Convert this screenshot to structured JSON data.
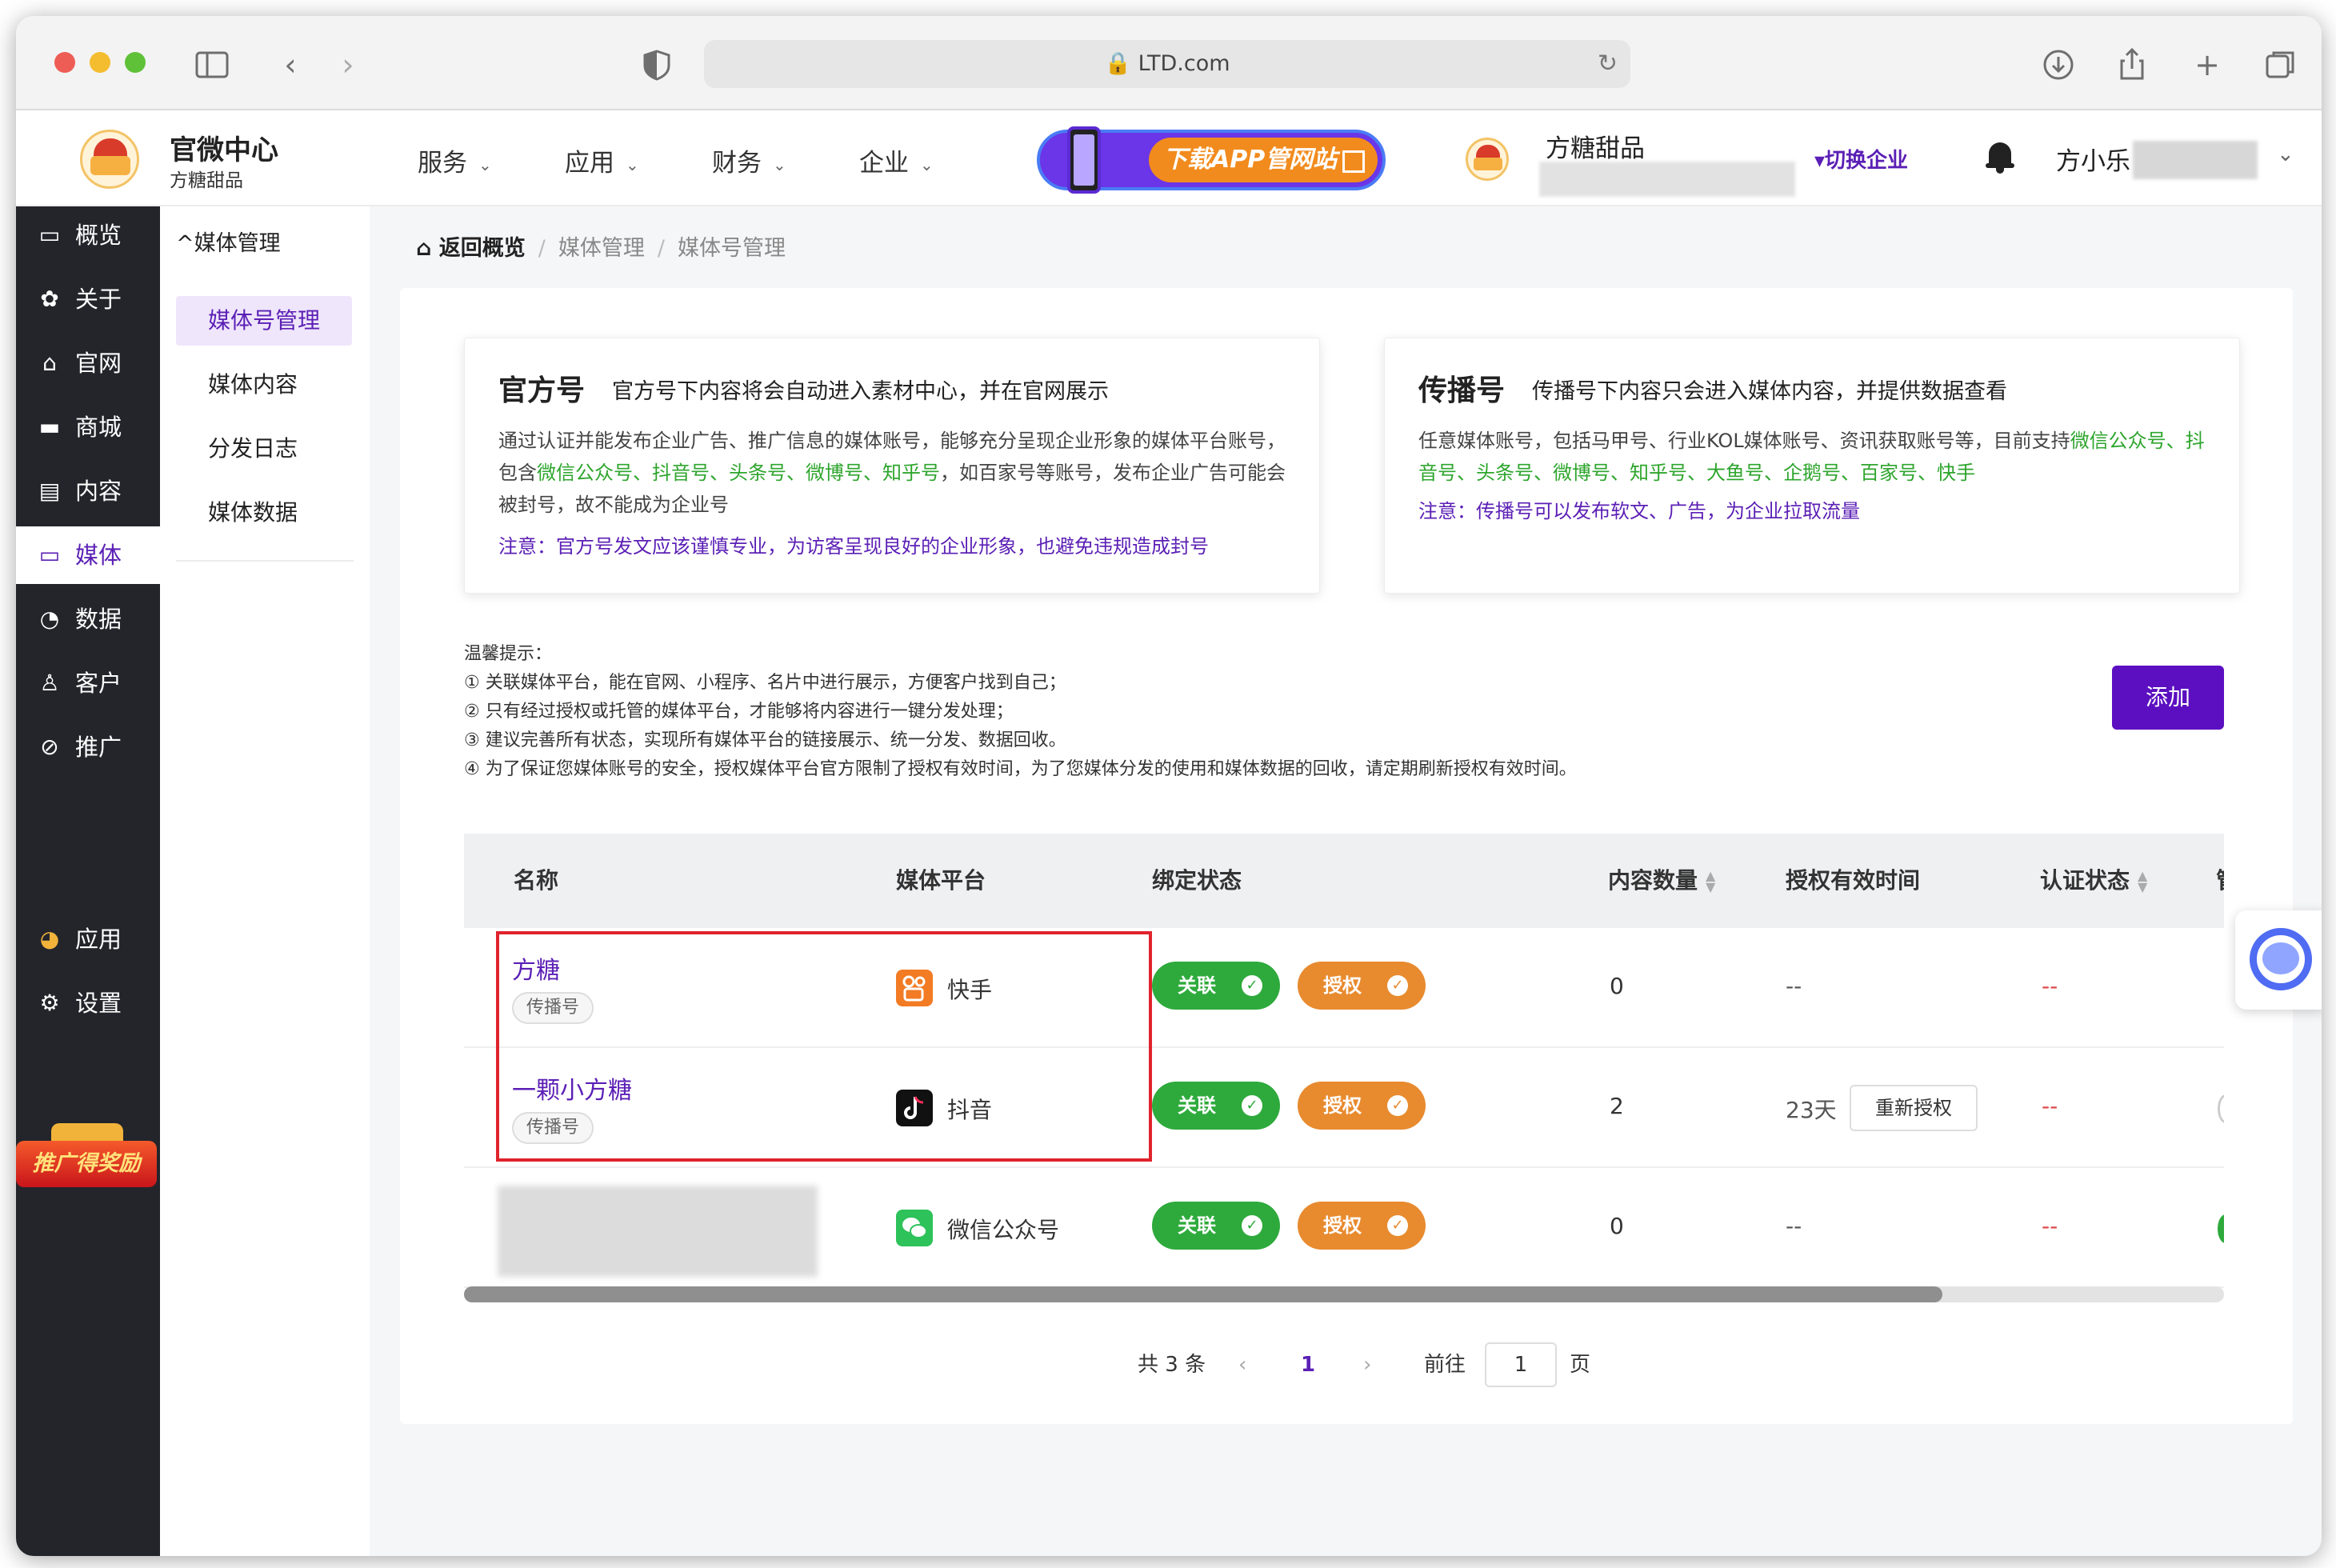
{
  "browser": {
    "url": "LTD.com",
    "colors": {
      "close": "#ee5d55",
      "minimize": "#f4bd2f",
      "zoom": "#5fc138"
    }
  },
  "header": {
    "brand_title": "官微中心",
    "brand_sub": "方糖甜品",
    "nav": [
      "服务",
      "应用",
      "财务",
      "企业"
    ],
    "promo_label": "下载APP管网站",
    "company": "方糖甜品",
    "switch_label": "▾切换企业",
    "username": "方小乐"
  },
  "leftnav": {
    "items": [
      {
        "icon": "dashboard-icon",
        "label": "概览"
      },
      {
        "icon": "gear-icon",
        "label": "关于"
      },
      {
        "icon": "home-icon",
        "label": "官网"
      },
      {
        "icon": "shop-icon",
        "label": "商城"
      },
      {
        "icon": "document-icon",
        "label": "内容"
      },
      {
        "icon": "video-icon",
        "label": "媒体"
      },
      {
        "icon": "pie-chart-icon",
        "label": "数据"
      },
      {
        "icon": "user-icon",
        "label": "客户"
      },
      {
        "icon": "link-icon",
        "label": "推广"
      },
      {
        "icon": "apps-icon",
        "label": "应用"
      },
      {
        "icon": "settings-icon",
        "label": "设置"
      }
    ],
    "promo_badge": "推广得奖励"
  },
  "subnav": {
    "title": "媒体管理",
    "items": [
      "媒体号管理",
      "媒体内容",
      "分发日志",
      "媒体数据"
    ]
  },
  "breadcrumb": [
    "返回概览",
    "媒体管理",
    "媒体号管理"
  ],
  "cards": {
    "official": {
      "title": "官方号",
      "desc": "官方号下内容将会自动进入素材中心，并在官网展示",
      "body_1": "通过认证并能发布企业广告、推广信息的媒体账号，能够充分呈现企业形象的媒体平台账号，包含",
      "body_hl": "微信公众号、抖音号、头条号、微博号、知乎号",
      "body_2": "，如百家号等账号，发布企业广告可能会被封号，故不能成为企业号",
      "note": "注意：官方号发文应该谨慎专业，为访客呈现良好的企业形象，也避免违规造成封号"
    },
    "broadcast": {
      "title": "传播号",
      "desc": "传播号下内容只会进入媒体内容，并提供数据查看",
      "body_1": "任意媒体账号，包括马甲号、行业KOL媒体账号、资讯获取账号等，目前支持",
      "body_hl": "微信公众号、抖音号、头条号、微博号、知乎号、大鱼号、企鹅号、百家号、快手",
      "note": "注意：传播号可以发布软文、广告，为企业拉取流量"
    }
  },
  "tips": {
    "title": "温馨提示：",
    "lines": [
      "① 关联媒体平台，能在官网、小程序、名片中进行展示，方便客户找到自己；",
      "② 只有经过授权或托管的媒体平台，才能够将内容进行一键分发处理；",
      "③ 建议完善所有状态，实现所有媒体平台的链接展示、统一分发、数据回收。",
      "④ 为了保证您媒体账号的安全，授权媒体平台官方限制了授权有效时间，为了您媒体分发的使用和媒体数据的回收，请定期刷新授权有效时间。"
    ]
  },
  "add_button": "添加",
  "table": {
    "headers": [
      "名称",
      "媒体平台",
      "绑定状态",
      "内容数量",
      "授权有效时间",
      "认证状态"
    ],
    "rows": [
      {
        "name": "方糖",
        "tag": "传播号",
        "platform": "快手",
        "platform_icon": "kuaishou-icon",
        "bind": "关联",
        "auth_btn": "授权",
        "count": "0",
        "auth_time": "--",
        "cert": "--"
      },
      {
        "name": "一颗小方糖",
        "tag": "传播号",
        "platform": "抖音",
        "platform_icon": "douyin-icon",
        "bind": "关联",
        "auth_btn": "授权",
        "count": "2",
        "auth_time": "23天",
        "reauth": "重新授权",
        "cert": "--"
      },
      {
        "name": "",
        "tag": "",
        "platform": "微信公众号",
        "platform_icon": "wechat-icon",
        "bind": "关联",
        "auth_btn": "授权",
        "count": "0",
        "auth_time": "--",
        "cert": "--"
      }
    ],
    "scroll_fraction": 0.84
  },
  "pagination": {
    "total": "共 3 条",
    "current": "1",
    "goto": "前往",
    "page_input": "1",
    "page_suffix": "页"
  }
}
